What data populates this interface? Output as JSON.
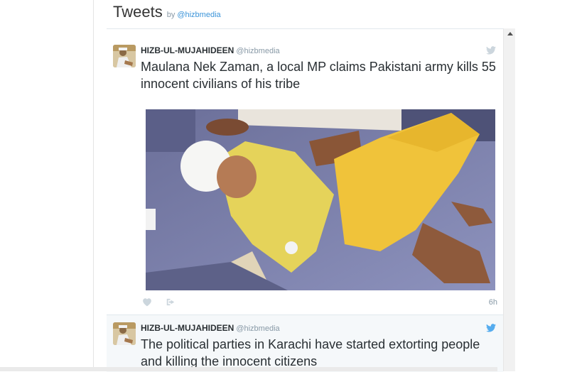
{
  "header": {
    "title": "Tweets",
    "by": "by",
    "handle": "@hizbmedia"
  },
  "tweets": [
    {
      "name": "HIZB-UL-MUJAHIDEEN",
      "handle": "@hizbmedia",
      "text": "Maulana Nek Zaman, a local MP claims Pakistani army kills 55 innocent civilians of his tribe",
      "time": "6h"
    },
    {
      "name": "HIZB-UL-MUJAHIDEEN",
      "handle": "@hizbmedia",
      "text": "The political parties in Karachi have started extorting people and killing the innocent citizens"
    }
  ],
  "icons": {
    "bird": "twitter-bird-icon",
    "heart": "heart-icon",
    "share": "share-icon",
    "scroll": "scroll-up-arrow-icon"
  },
  "colors": {
    "link": "#3b94d9",
    "text": "#292f33",
    "muted": "#8899a6",
    "bird_active": "#55acee",
    "bird_muted": "#ccd6dd"
  }
}
